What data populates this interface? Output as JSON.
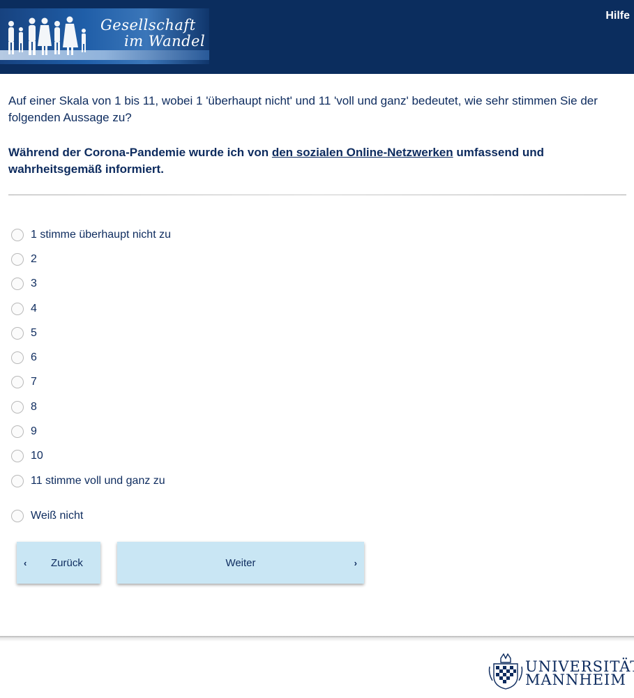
{
  "header": {
    "logo": {
      "line1": "Gesellschaft",
      "line2": "im Wandel"
    },
    "help_label": "Hilfe"
  },
  "question": {
    "text": "Auf einer Skala von 1 bis 11, wobei 1 'überhaupt nicht' und 11 'voll und ganz' bedeutet, wie sehr stimmen Sie der folgenden Aussage zu?",
    "statement_before": "Während der Corona-Pandemie wurde ich von ",
    "statement_link": "den sozialen Online-Netzwerken",
    "statement_after": " umfassend und wahrheitsgemäß informiert."
  },
  "options": [
    {
      "label": "1 stimme überhaupt nicht zu",
      "selected": false
    },
    {
      "label": "2",
      "selected": false
    },
    {
      "label": "3",
      "selected": false
    },
    {
      "label": "4",
      "selected": false
    },
    {
      "label": "5",
      "selected": false
    },
    {
      "label": "6",
      "selected": false
    },
    {
      "label": "7",
      "selected": false
    },
    {
      "label": "8",
      "selected": false
    },
    {
      "label": "9",
      "selected": false
    },
    {
      "label": "10",
      "selected": false
    },
    {
      "label": "11 stimme voll und ganz zu",
      "selected": false
    },
    {
      "label": "Weiß nicht",
      "selected": false
    }
  ],
  "nav": {
    "back_label": "Zurück",
    "next_label": "Weiter",
    "back_icon": "chevron-left-icon",
    "next_icon": "chevron-right-icon"
  },
  "footer": {
    "university_line1": "UNIVERSITÄT",
    "university_line2": "MANNHEIM"
  },
  "colors": {
    "header_bg": "#0b2d5e",
    "text": "#0d2b5e",
    "button_bg": "#c9e6f4"
  }
}
